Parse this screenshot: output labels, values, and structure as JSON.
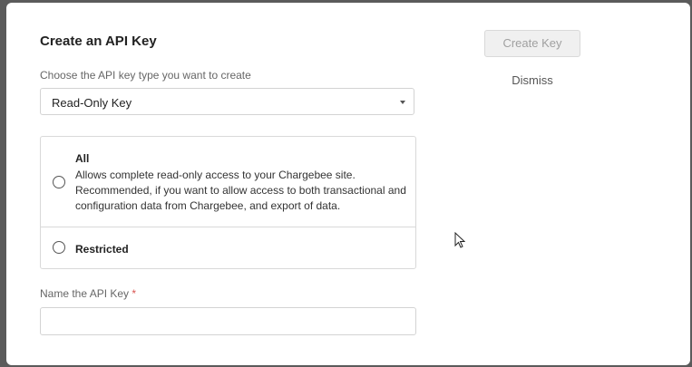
{
  "modal": {
    "title": "Create an API Key",
    "key_type_label": "Choose the API key type you want to create",
    "key_type_selected": "Read-Only Key",
    "options": [
      {
        "title": "All",
        "description": "Allows complete read-only access to your Chargebee site. Recommended, if you want to allow access to both transactional and configuration data from Chargebee, and export of data.",
        "selected": false
      },
      {
        "title": "Restricted",
        "selected": false
      }
    ],
    "name_label": "Name the API Key",
    "required_marker": "*",
    "name_value": "",
    "create_button": "Create Key",
    "dismiss_link": "Dismiss"
  },
  "icons": {
    "select_caret": "chevron-down-icon",
    "cursor": "mouse-pointer-icon"
  },
  "colors": {
    "required": "#d9534f",
    "disabled_button_text": "#a0a0a0"
  }
}
